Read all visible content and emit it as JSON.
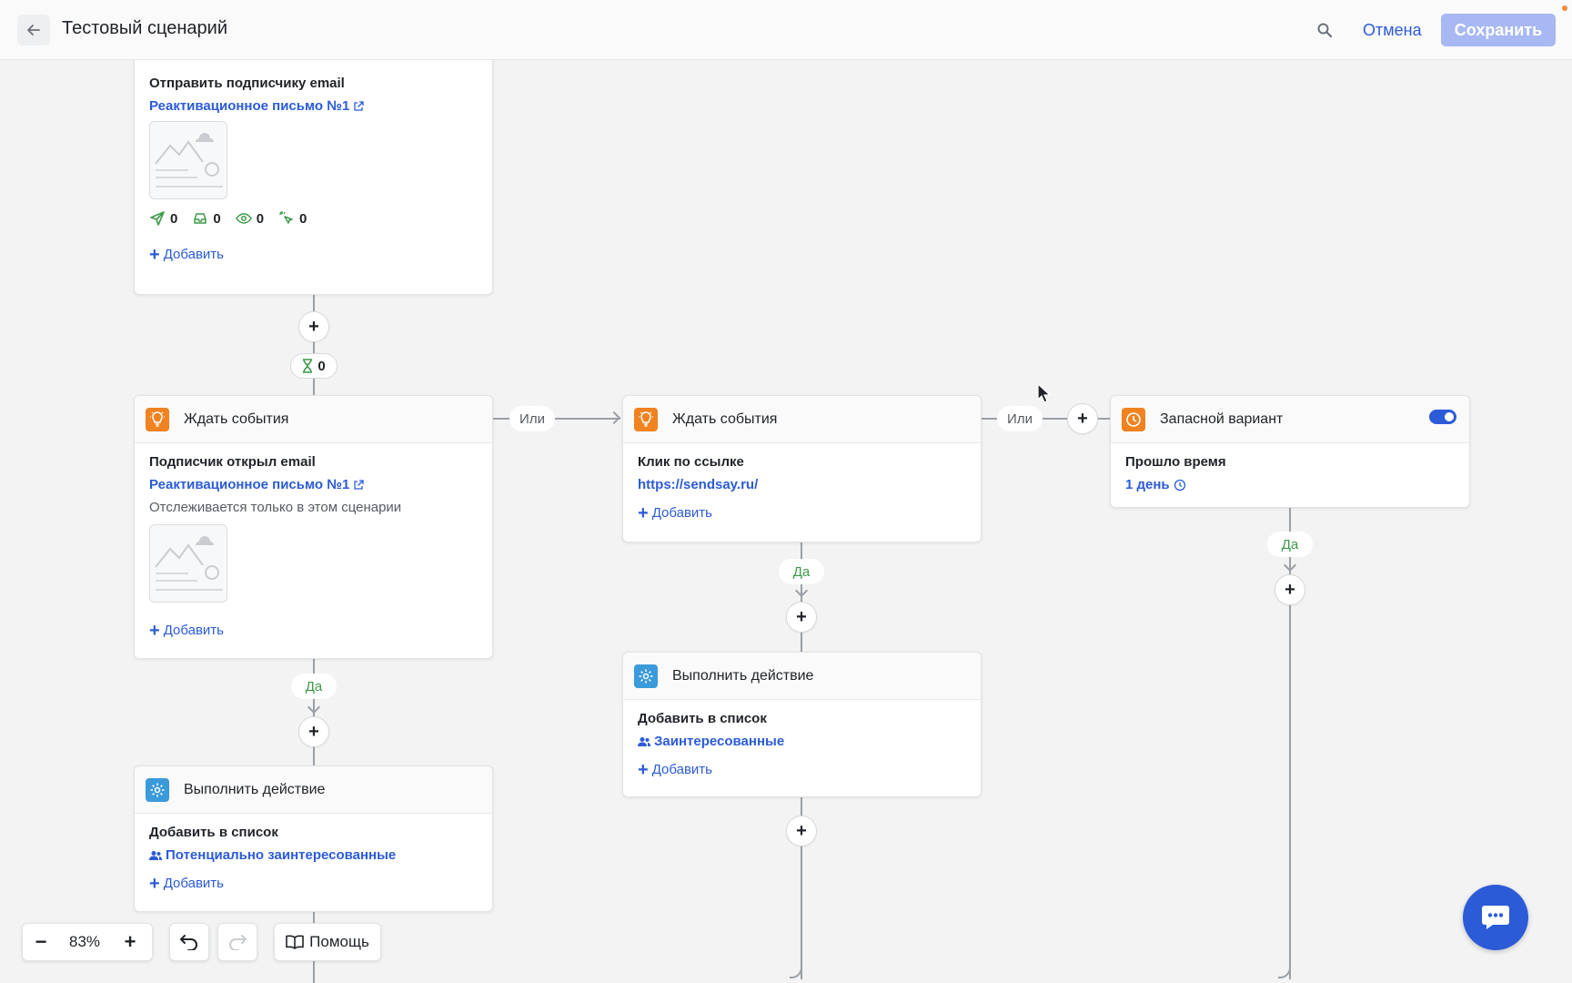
{
  "header": {
    "title": "Тестовый сценарий",
    "cancel_label": "Отмена",
    "save_label": "Сохранить"
  },
  "cards": {
    "send_email": {
      "title": "Отправить подписчику email",
      "link": "Реактивационное письмо №1",
      "stats": [
        {
          "icon": "sent-icon",
          "value": "0"
        },
        {
          "icon": "inbox-icon",
          "value": "0"
        },
        {
          "icon": "eye-icon",
          "value": "0"
        },
        {
          "icon": "click-icon",
          "value": "0"
        }
      ],
      "add_label": "Добавить"
    },
    "wait_1": {
      "header": "Ждать события",
      "title": "Подписчик открыл email",
      "link": "Реактивационное письмо №1",
      "note": "Отслеживается только в этом сценарии",
      "add_label": "Добавить"
    },
    "wait_2": {
      "header": "Ждать события",
      "title": "Клик по ссылке",
      "link": "https://sendsay.ru/",
      "add_label": "Добавить"
    },
    "fallback": {
      "header": "Запасной вариант",
      "title": "Прошло время",
      "link": "1 день",
      "toggle_on": true
    },
    "action_1": {
      "header": "Выполнить действие",
      "title": "Добавить в список",
      "link": "Потенциально заинтересованные",
      "add_label": "Добавить"
    },
    "action_2": {
      "header": "Выполнить действие",
      "title": "Добавить в список",
      "link": "Заинтересованные",
      "add_label": "Добавить"
    }
  },
  "connectors": {
    "delay_value": "0",
    "or_label": "Или",
    "yes_label": "Да"
  },
  "toolbar": {
    "zoom": "83%",
    "help_label": "Помощь"
  },
  "colors": {
    "accent": "#2b5bd7",
    "event_icon": "#f0821f",
    "action_icon": "#3b9ad9",
    "yes": "#3c9a48"
  }
}
